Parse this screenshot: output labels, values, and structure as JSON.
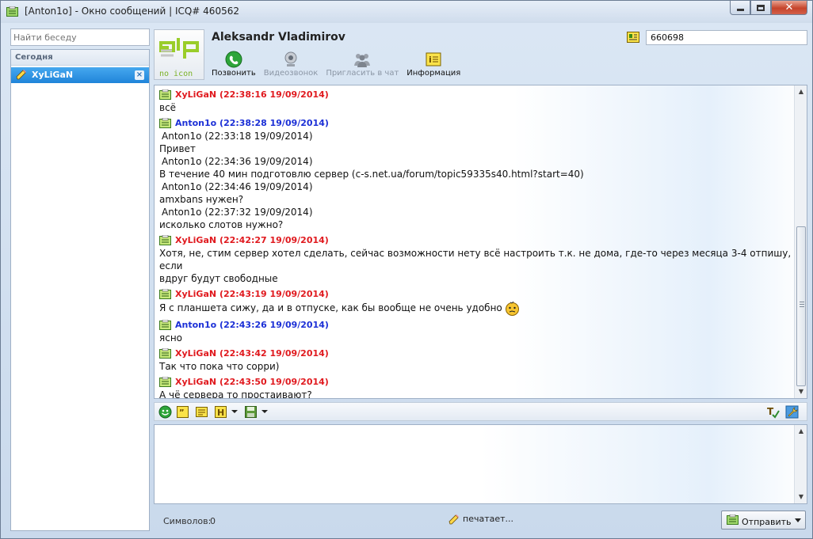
{
  "window": {
    "title": "[Anton1o] - Окно сообщений | ICQ# 460562",
    "icon": "clipboard-icon"
  },
  "sidebar": {
    "search_placeholder": "Найти беседу",
    "group": "Сегодня",
    "contacts": [
      {
        "name": "XyLiGaN",
        "icon": "pencil-icon",
        "close": "×"
      }
    ]
  },
  "contact": {
    "name": "Aleksandr Vladimirov",
    "uin": "660698",
    "avatar_text": "no icon"
  },
  "toolbar": {
    "call": "Позвонить",
    "video": "Видеозвонок",
    "invite": "Пригласить в чат",
    "info": "Информация"
  },
  "messages": [
    {
      "author": "XyLiGaN",
      "dir": "in",
      "time": "(22:38:16 19/09/2014)",
      "lines": [
        {
          "text": "всё"
        }
      ]
    },
    {
      "author": "Anton1o",
      "dir": "out",
      "time": "(22:38:28 19/09/2014)",
      "lines": [
        {
          "text": "Anton1o (22:33:18 19/09/2014)",
          "quote": true
        },
        {
          "text": "Привет"
        },
        {
          "text": "Anton1o (22:34:36 19/09/2014)",
          "quote": true
        },
        {
          "text": "В течение 40 мин подготовлю сервер (c-s.net.ua/forum/topic59335s40.html?start=40)"
        },
        {
          "text": "Anton1o (22:34:46 19/09/2014)",
          "quote": true
        },
        {
          "text": "amxbans нужен?"
        },
        {
          "text": "Anton1o (22:37:32 19/09/2014)",
          "quote": true
        },
        {
          "text": "исколько слотов нужно?"
        }
      ]
    },
    {
      "author": "XyLiGaN",
      "dir": "in",
      "time": "(22:42:27 19/09/2014)",
      "lines": [
        {
          "text": "Хотя, не, стим сервер хотел сделать, сейчас возможности нету всё настроить т.к. не дома, где-то через месяца 3-4 отпишу, если"
        },
        {
          "text": "вдруг будут свободные"
        }
      ]
    },
    {
      "author": "XyLiGaN",
      "dir": "in",
      "time": "(22:43:19 19/09/2014)",
      "lines": [
        {
          "text": "Я с планшета сижу, да и в отпуске, как бы вообще не очень удобно",
          "emoticon": "confused-face-icon"
        }
      ]
    },
    {
      "author": "Anton1o",
      "dir": "out",
      "time": "(22:43:26 19/09/2014)",
      "lines": [
        {
          "text": "ясно"
        }
      ]
    },
    {
      "author": "XyLiGaN",
      "dir": "in",
      "time": "(22:43:42 19/09/2014)",
      "lines": [
        {
          "text": "Так что пока что сорри)"
        }
      ]
    },
    {
      "author": "XyLiGaN",
      "dir": "in",
      "time": "(22:43:50 19/09/2014)",
      "lines": [
        {
          "text": "А чё сервера то простаивают?"
        }
      ]
    }
  ],
  "status": {
    "chars_label": "Символов:",
    "chars_value": "0",
    "typing": "печатает...",
    "send": "Отправить"
  },
  "colors": {
    "incoming": "#e0191e",
    "outgoing": "#1b2fd6",
    "selection": "#2a90e4"
  }
}
